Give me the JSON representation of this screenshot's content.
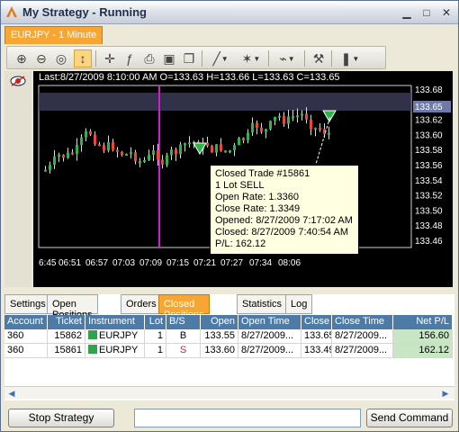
{
  "window": {
    "title": "My Strategy - Running"
  },
  "chart_tab": "EURJPY - 1 Minute",
  "chart_info": "Last:8/27/2009 8:10:00 AM O=133.63 H=133.66 L=133.63 C=133.65",
  "price_axis": [
    "133.68",
    "133.65",
    "133.62",
    "133.60",
    "133.58",
    "133.56",
    "133.54",
    "133.52",
    "133.50",
    "133.48",
    "133.46"
  ],
  "current_price": "133.65",
  "time_axis": [
    "6:45",
    "06:51",
    "06:57",
    "07:03",
    "07:09",
    "07:15",
    "07:21",
    "07:27",
    "07:34",
    "08:06"
  ],
  "tooltip": {
    "line1": "Closed Trade #15861",
    "line2": "1 Lot SELL",
    "line3": "Open Rate: 1.3360",
    "line4": "Close Rate: 1.3349",
    "line5": "Opened: 8/27/2009 7:17:02 AM",
    "line6": "Closed: 8/27/2009 7:40:54 AM",
    "line7": "P/L: 162.12"
  },
  "bottom_tabs": [
    "Settings",
    "Open Positions",
    "Orders",
    "Closed Positions",
    "Statistics",
    "Log"
  ],
  "columns": [
    "Account",
    "Ticket",
    "Instrument",
    "Lot",
    "B/S",
    "Open",
    "Open Time",
    "Close",
    "Close Time",
    "Net P/L"
  ],
  "rows": [
    {
      "account": "360",
      "ticket": "15862",
      "instrument": "EURJPY",
      "lot": "1",
      "bs": "B",
      "open": "133.55",
      "open_time": "8/27/2009...",
      "close": "133.65",
      "close_time": "8/27/2009...",
      "netpl": "156.60"
    },
    {
      "account": "360",
      "ticket": "15861",
      "instrument": "EURJPY",
      "lot": "1",
      "bs": "S",
      "open": "133.60",
      "open_time": "8/27/2009...",
      "close": "133.49",
      "close_time": "8/27/2009...",
      "netpl": "162.12"
    }
  ],
  "buttons": {
    "stop": "Stop Strategy",
    "send": "Send Command"
  },
  "colors": {
    "accent": "#f7a633",
    "header": "#4e7aa6",
    "bull": "#2fb34a",
    "bear": "#e8483d",
    "marker": "#d21bd2"
  }
}
